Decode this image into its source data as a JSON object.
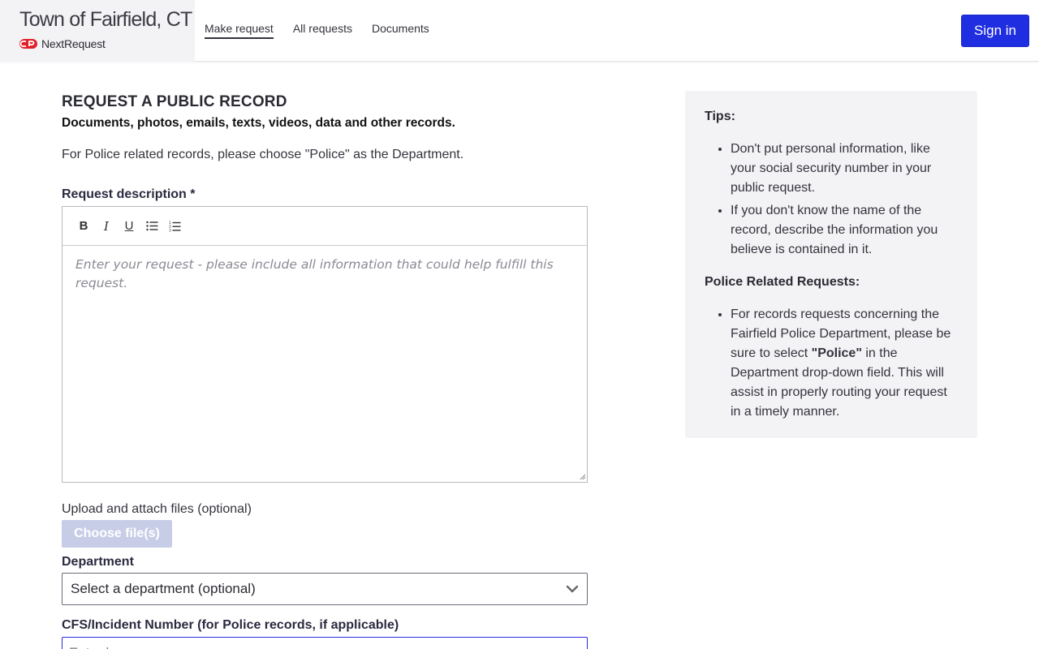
{
  "header": {
    "town_title": "Town of Fairfield, CT",
    "logo_text": "NextRequest",
    "nav": [
      "Make request",
      "All requests",
      "Documents"
    ],
    "signin_label": "Sign in",
    "accent_color": "#1f2ee0"
  },
  "form": {
    "page_title": "REQUEST A PUBLIC RECORD",
    "subtitle": "Documents, photos, emails, texts, videos, data and other records.",
    "intro": "For Police related records, please choose \"Police\" as the Department.",
    "description_label": "Request description *",
    "toolbar": {
      "bold": "B",
      "italic": "I",
      "underline": "U",
      "bullet_list_icon": "bullet-list-icon",
      "numbered_list_icon": "numbered-list-icon"
    },
    "description_placeholder": "Enter your request - please include all information that could help fulfill this request.",
    "upload_label": "Upload and attach files (optional)",
    "choose_files_label": "Choose file(s)",
    "department_label": "Department",
    "department_selected": "Select a department (optional)",
    "cfs_label": "CFS/Incident Number (for Police records, if applicable)",
    "cfs_placeholder": "Enter here..."
  },
  "tips": {
    "heading": "Tips:",
    "items": [
      "Don't put personal information, like your social security number in your public request.",
      "If you don't know the name of the record, describe the information you believe is contained in it."
    ],
    "police_heading": "Police Related Requests:",
    "police_text_before": "For records requests concerning the Fairfield Police Department, please be sure to select ",
    "police_bold": "\"Police\"",
    "police_text_after": " in the Department drop-down field. This will assist in properly routing your request in a timely manner."
  }
}
